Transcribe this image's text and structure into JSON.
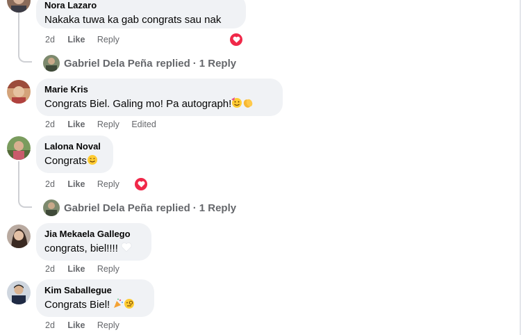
{
  "comments": [
    {
      "author": "Nora Lazaro",
      "text": "Nakaka tuwa ka gab congrats sau nak",
      "time": "2d",
      "like": "Like",
      "reply": "Reply",
      "reaction": "heart",
      "replies_line": {
        "replier": "Gabriel Dela Peña",
        "text": "replied",
        "count": "1 Reply"
      }
    },
    {
      "author": "Marie Kris",
      "text": "Congrats Biel. Galing mo! Pa autograph!",
      "emojis": [
        "party-face",
        "clapping-hands"
      ],
      "time": "2d",
      "like": "Like",
      "reply": "Reply",
      "edited": "Edited"
    },
    {
      "author": "Lalona Noval",
      "text": "Congrats",
      "emojis": [
        "smiling-face"
      ],
      "time": "2d",
      "like": "Like",
      "reply": "Reply",
      "reaction": "heart",
      "replies_line": {
        "replier": "Gabriel Dela Peña",
        "text": "replied",
        "count": "1 Reply"
      }
    },
    {
      "author": "Jia Mekaela Gallego",
      "text": "congrats, biel!!!!",
      "emojis": [
        "white-heart"
      ],
      "time": "2d",
      "like": "Like",
      "reply": "Reply"
    },
    {
      "author": "Kim Saballegue",
      "text": "Congrats Biel!",
      "emojis": [
        "party-popper",
        "monocle-face"
      ],
      "time": "2d",
      "like": "Like",
      "reply": "Reply"
    }
  ],
  "colors": {
    "bubble": "#f0f2f5",
    "meta": "#65676b",
    "heart": "#f02849",
    "thread": "#ced0d4"
  }
}
